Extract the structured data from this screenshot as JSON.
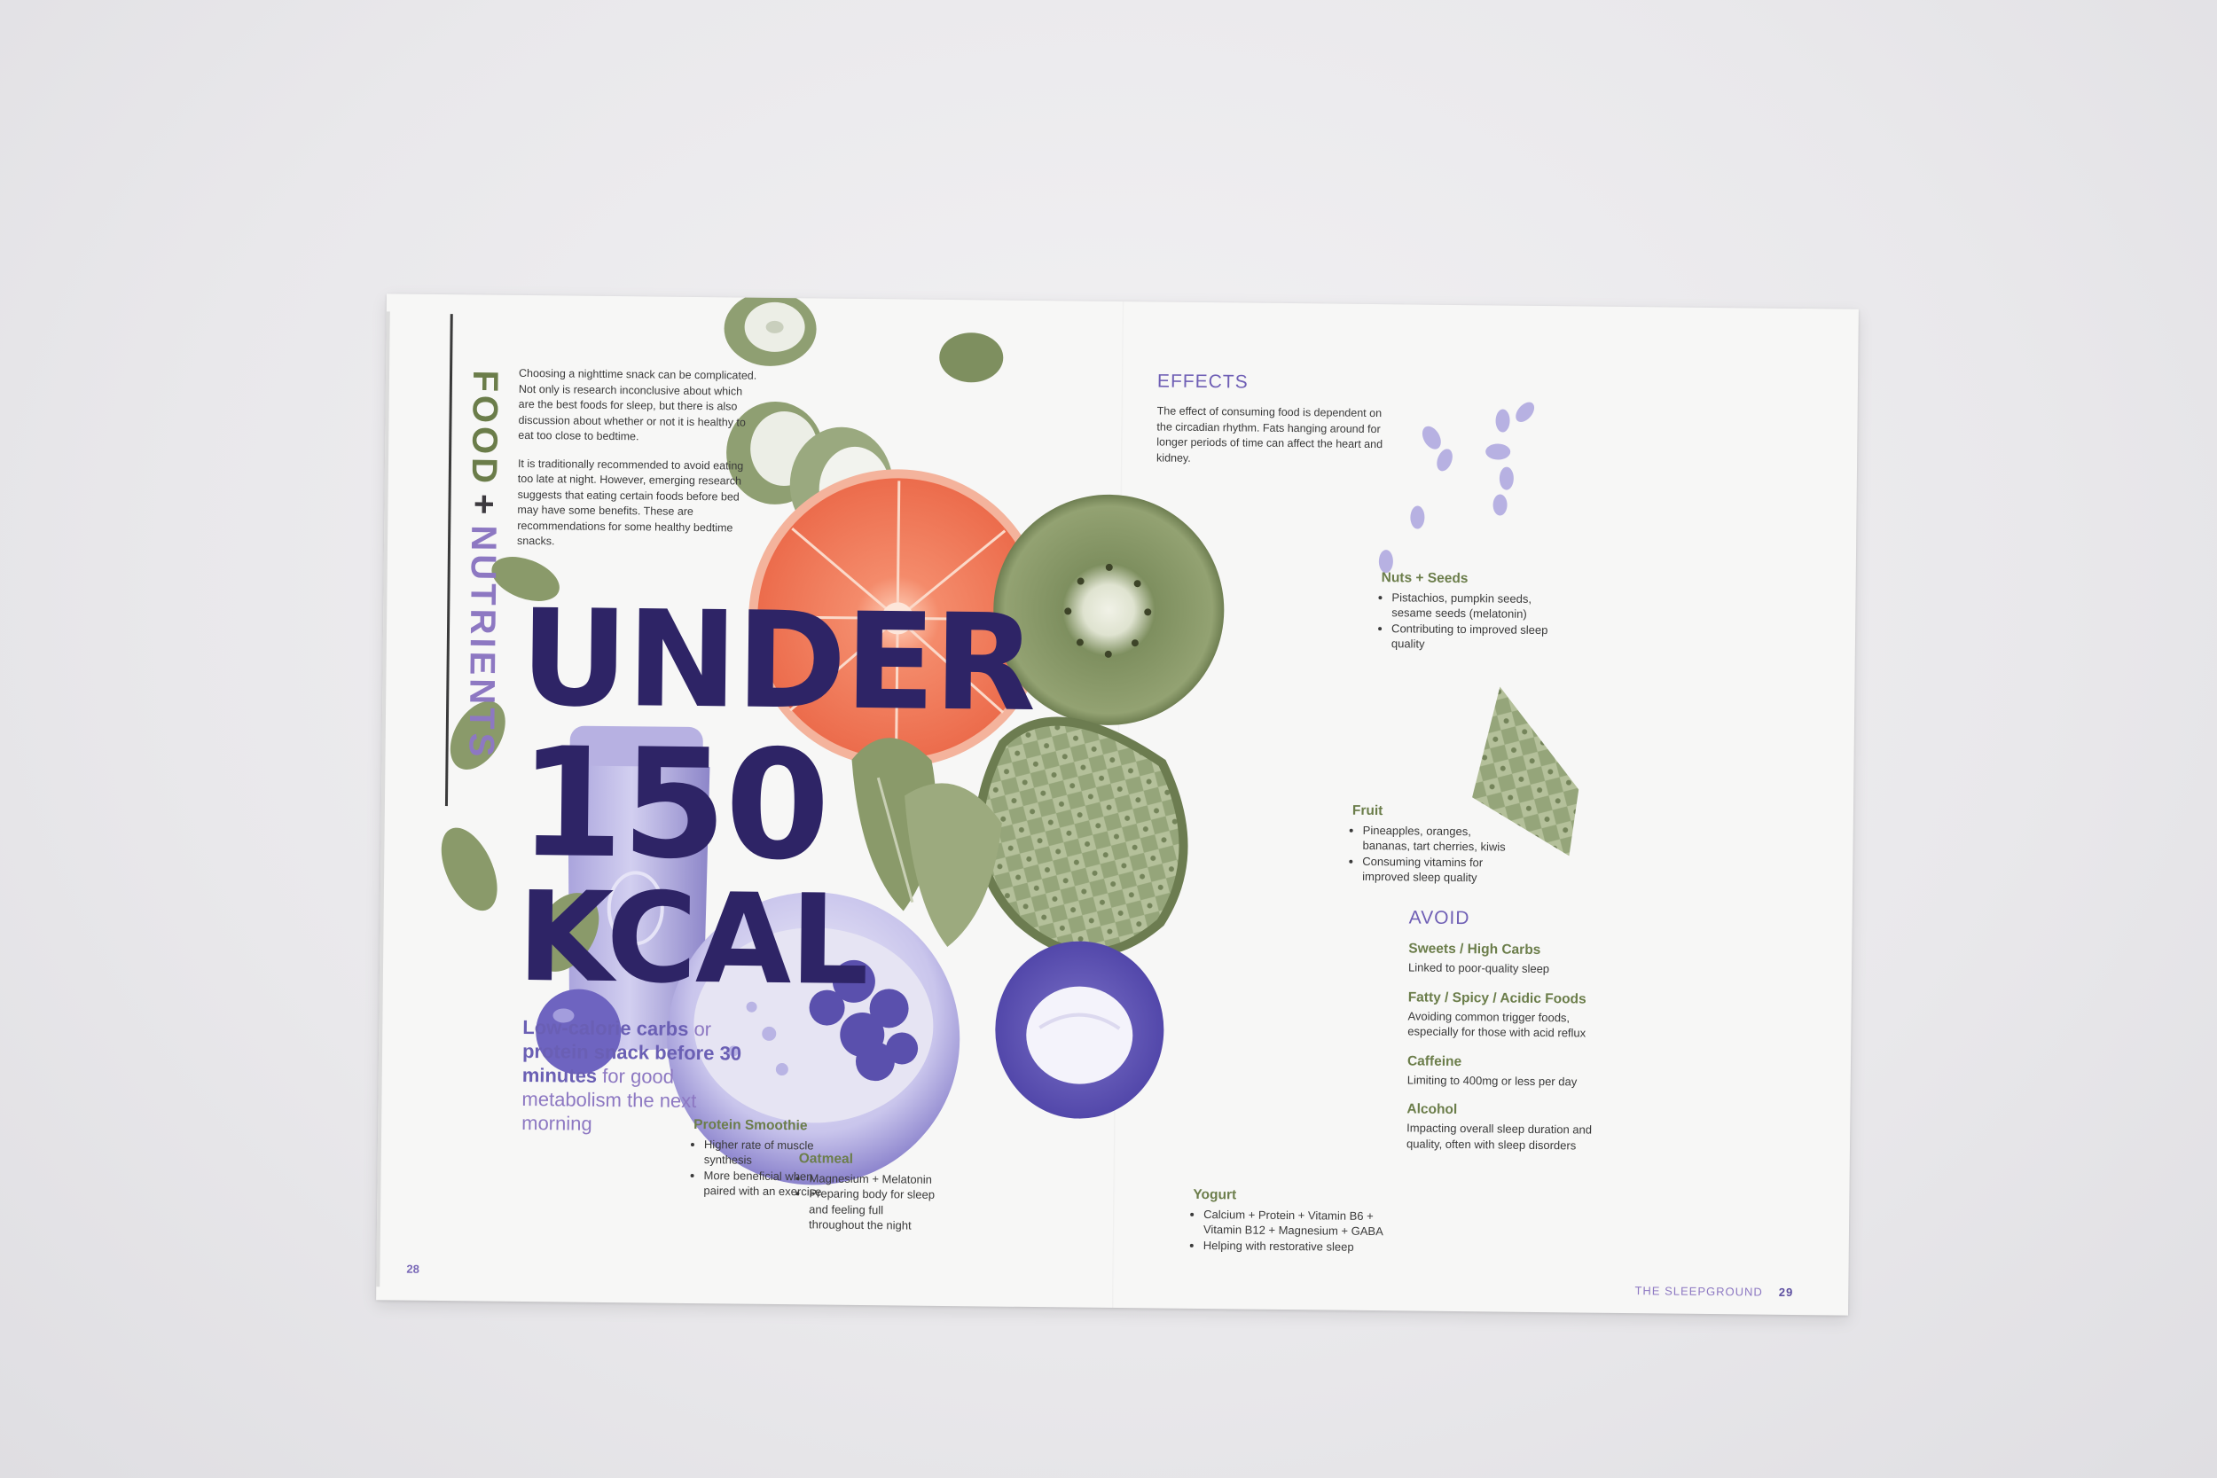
{
  "left_page": {
    "section_title_part1": "FOOD",
    "section_title_plus": "+",
    "section_title_part2": "NUTRIENTS",
    "intro_paragraph_1": "Choosing a nighttime snack can be complicated. Not only is research inconclusive about which are the best foods for sleep, but there is also discussion about whether or not it is healthy to eat too close to bedtime.",
    "intro_paragraph_2": "It is traditionally recommended to avoid eating too late at night. However, emerging research suggests that eating certain foods before bed may have some benefits. These are recommendations for some healthy bedtime snacks.",
    "headline_line1": "UNDER",
    "headline_line2": "150",
    "headline_line3": "KCAL",
    "tagline_strong": "Low-calorie carbs",
    "tagline_or": "or",
    "tagline_strong2": "protein snack before 30 minutes",
    "tagline_rest": "for good metabolism the next morning",
    "page_number": "28"
  },
  "snacks": {
    "protein_smoothie": {
      "title": "Protein Smoothie",
      "bullets": [
        "Higher rate of muscle synthesis",
        "More beneficial when paired with an exercise"
      ]
    },
    "oatmeal": {
      "title": "Oatmeal",
      "bullets": [
        "Magnesium + Melatonin",
        "Preparing body for sleep and feeling full throughout the night"
      ]
    },
    "yogurt": {
      "title": "Yogurt",
      "bullets": [
        "Calcium + Protein + Vitamin B6 + Vitamin B12 + Magnesium + GABA",
        "Helping with restorative sleep"
      ]
    },
    "nuts_seeds": {
      "title": "Nuts + Seeds",
      "bullets": [
        "Pistachios, pumpkin seeds, sesame seeds (melatonin)",
        "Contributing to improved sleep quality"
      ]
    },
    "fruit": {
      "title": "Fruit",
      "bullets": [
        "Pineapples, oranges, bananas, tart cherries, kiwis",
        "Consuming vitamins for improved sleep quality"
      ]
    }
  },
  "right_page": {
    "effects_title": "EFFECTS",
    "effects_body": "The effect of consuming food is dependent on the circadian rhythm. Fats hanging around for longer periods of time can affect the heart and kidney.",
    "avoid_title": "AVOID",
    "avoid_items": [
      {
        "title": "Sweets / High Carbs",
        "body": "Linked to poor-quality sleep"
      },
      {
        "title": "Fatty / Spicy / Acidic Foods",
        "body": "Avoiding common trigger foods, especially for those with acid reflux"
      },
      {
        "title": "Caffeine",
        "body": "Limiting to 400mg or less per day"
      },
      {
        "title": "Alcohol",
        "body": "Impacting overall sleep duration and quality, often with sleep disorders"
      }
    ],
    "footer_publication": "THE SLEEPGROUND",
    "page_number": "29"
  },
  "colors": {
    "headline_purple": "#2e2466",
    "accent_lavender": "#8d78c2",
    "olive_green": "#6b7d4a",
    "orange": "#f07a5a"
  }
}
